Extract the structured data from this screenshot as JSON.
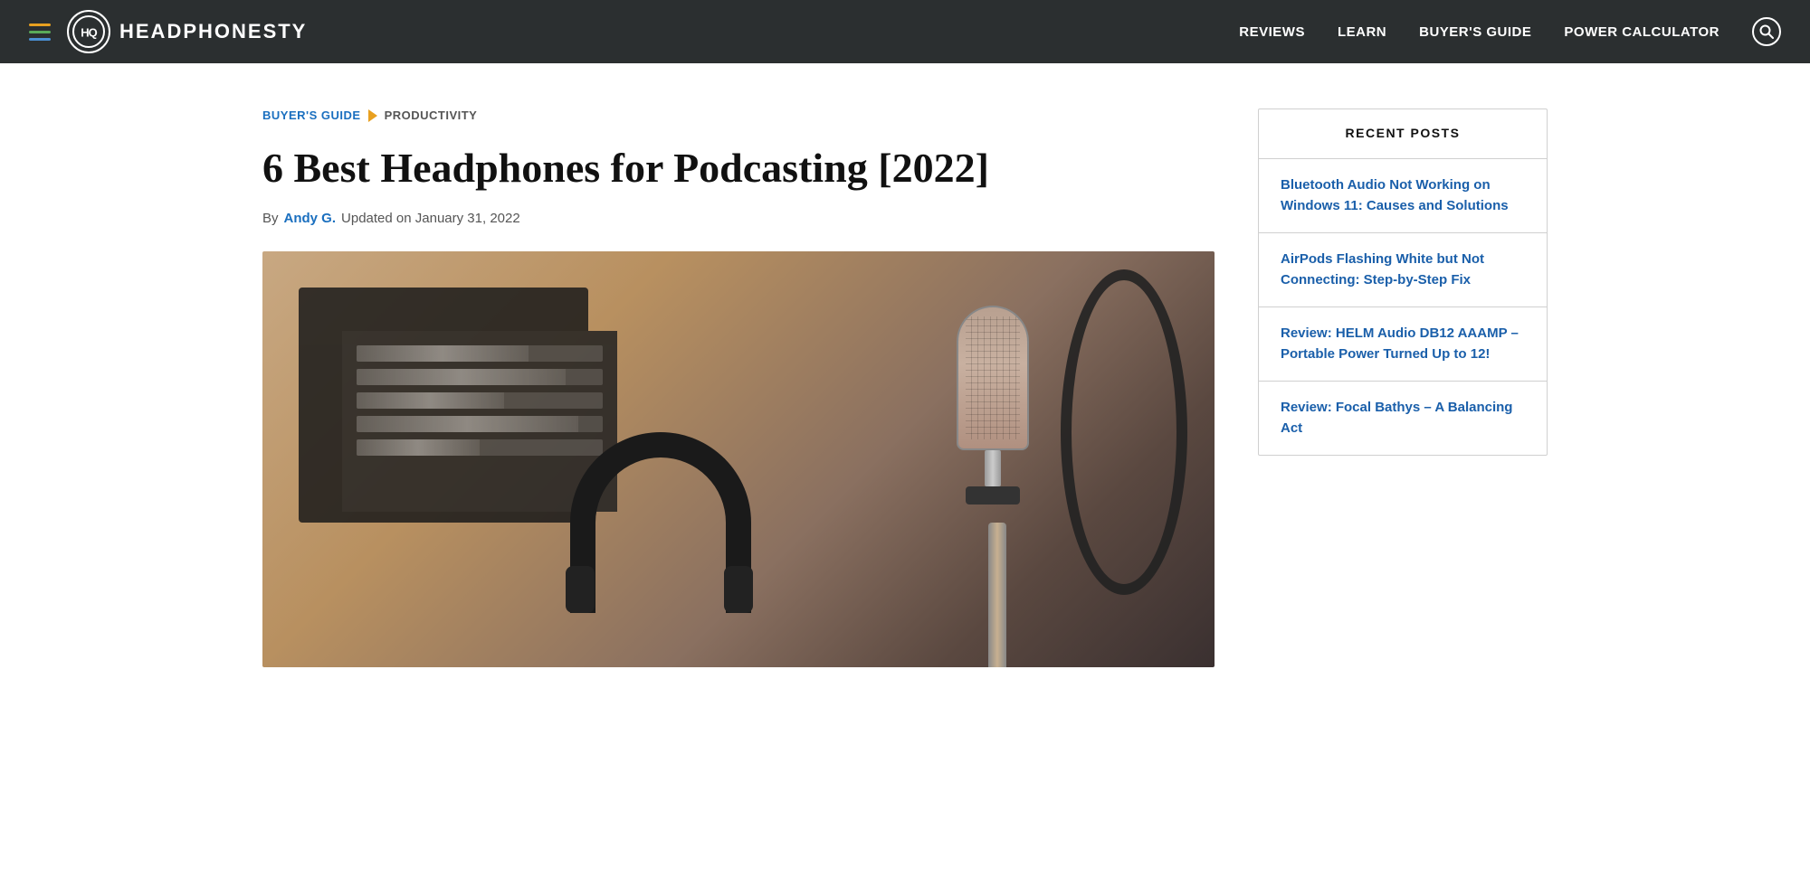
{
  "nav": {
    "hamburger_label": "Menu",
    "logo_initials": "HQ",
    "logo_text": "HEADPHONESTY",
    "links": [
      {
        "id": "reviews",
        "label": "REVIEWS"
      },
      {
        "id": "learn",
        "label": "LEARN"
      },
      {
        "id": "buyers-guide",
        "label": "BUYER'S GUIDE"
      },
      {
        "id": "power-calculator",
        "label": "POWER CALCULATOR"
      }
    ],
    "search_label": "Search"
  },
  "breadcrumb": {
    "parent_label": "BUYER'S GUIDE",
    "child_label": "PRODUCTIVITY"
  },
  "article": {
    "title": "6 Best Headphones for Podcasting [2022]",
    "by_label": "By",
    "author": "Andy G.",
    "meta_separator": "Updated on January 31, 2022"
  },
  "sidebar": {
    "recent_posts_title": "RECENT POSTS",
    "posts": [
      {
        "id": "post-1",
        "title": "Bluetooth Audio Not Working on Windows 11: Causes and Solutions"
      },
      {
        "id": "post-2",
        "title": "AirPods Flashing White but Not Connecting: Step-by-Step Fix"
      },
      {
        "id": "post-3",
        "title": "Review: HELM Audio DB12 AAAMP – Portable Power Turned Up to 12!"
      },
      {
        "id": "post-4",
        "title": "Review: Focal Bathys – A Balancing Act"
      }
    ]
  }
}
